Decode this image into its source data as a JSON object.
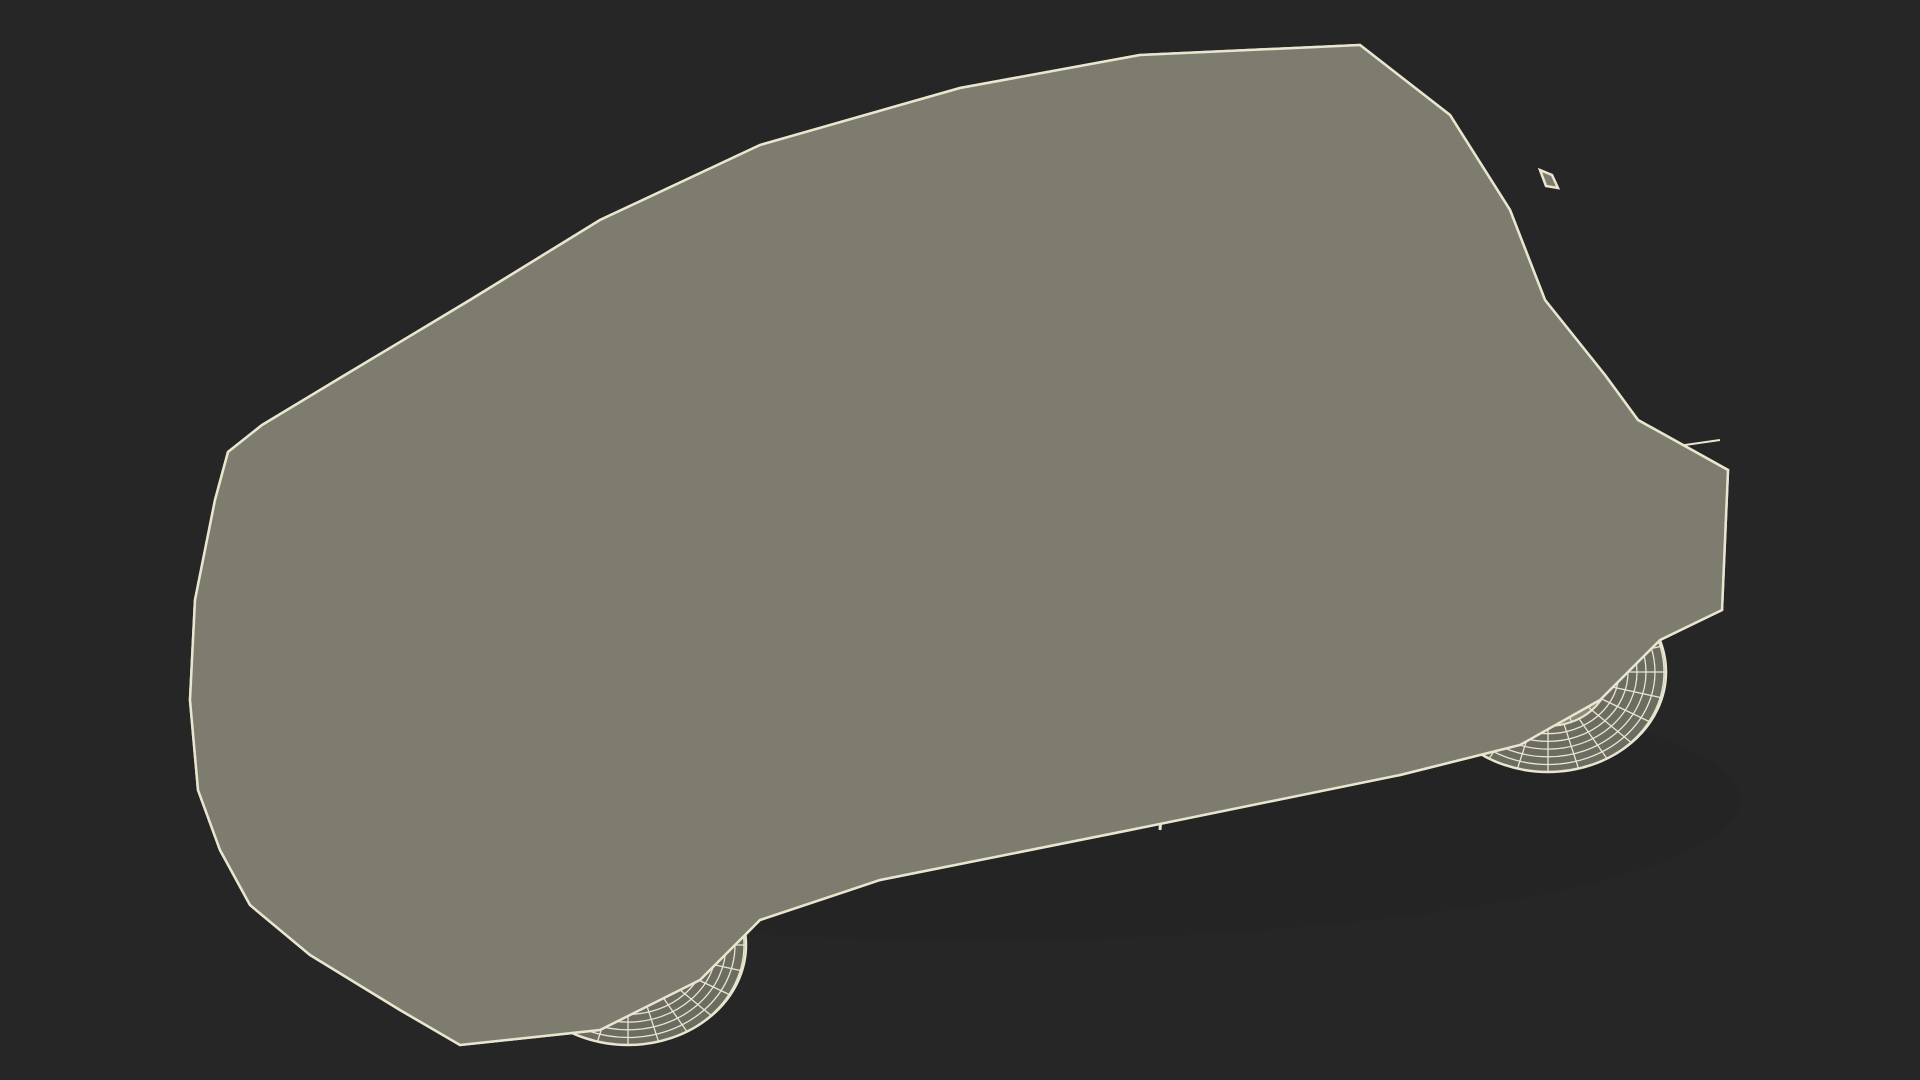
{
  "scene": {
    "subject": "hatchback-car-wireframe-render",
    "colors": {
      "background": "#262626",
      "body_fill": "#7d7c6e",
      "glass_fill": "#6c6b5f",
      "roof_fill": "#84836f",
      "shadow_fill": "#5e5d53",
      "wire": "#e9e6cf",
      "tire_fill": "#6d6c61",
      "rim_fill": "#8c8b7b"
    }
  }
}
